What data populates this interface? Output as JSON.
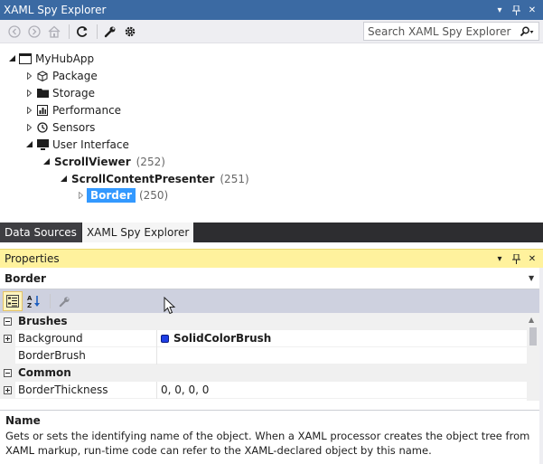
{
  "explorer": {
    "title": "XAML Spy Explorer",
    "search_placeholder": "Search XAML Spy Explorer",
    "toolbar_icons": [
      "back-icon",
      "forward-icon",
      "home-icon",
      "refresh-icon",
      "wrench-icon",
      "gear-icon",
      "search-icon"
    ]
  },
  "tree": {
    "root": "MyHubApp",
    "items": [
      {
        "label": "Package"
      },
      {
        "label": "Storage"
      },
      {
        "label": "Performance"
      },
      {
        "label": "Sensors"
      },
      {
        "label": "User Interface"
      }
    ],
    "scrollviewer": {
      "label": "ScrollViewer",
      "count": "(252)"
    },
    "scrollcontentpresenter": {
      "label": "ScrollContentPresenter",
      "count": "(251)"
    },
    "border": {
      "label": "Border",
      "count": "(250)"
    }
  },
  "tabs": [
    {
      "label": "Data Sources"
    },
    {
      "label": "XAML Spy Explorer"
    }
  ],
  "properties": {
    "title": "Properties",
    "selected_object": "Border",
    "categories": [
      {
        "name": "Brushes"
      },
      {
        "name": "Common"
      }
    ],
    "rows": [
      {
        "name": "Background",
        "value": "SolidColorBrush"
      },
      {
        "name": "BorderBrush",
        "value": ""
      },
      {
        "name": "BorderThickness",
        "value": "0, 0, 0, 0"
      }
    ],
    "swatch_color": "#1f3fe6",
    "description": {
      "title": "Name",
      "text": "Gets or sets the identifying name of the object. When a XAML processor creates the object tree from XAML markup, run-time code can refer to the XAML-declared object by this name."
    }
  },
  "colors": {
    "title_bar": "#3b6aa3",
    "properties_title": "#fff29d",
    "selection": "#3399ff"
  }
}
